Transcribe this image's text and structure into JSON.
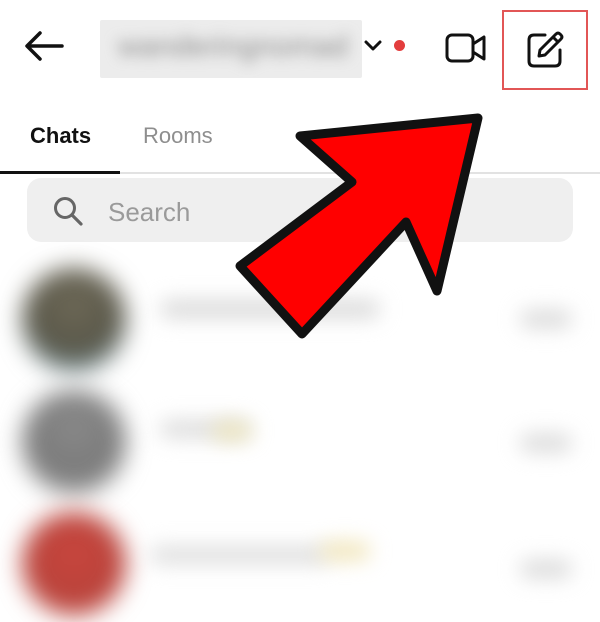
{
  "header": {
    "username": "wanderingnomad",
    "back_icon": "back-arrow-icon",
    "dropdown_icon": "chevron-down-icon",
    "video_icon": "video-camera-icon",
    "compose_icon": "edit-compose-icon"
  },
  "tabs": [
    {
      "label": "Chats",
      "active": true
    },
    {
      "label": "Rooms",
      "active": false
    }
  ],
  "search": {
    "placeholder": "Search",
    "value": "",
    "icon": "search-icon"
  },
  "annotation": {
    "type": "arrow",
    "color": "#ff0000",
    "points_to": "compose-button"
  },
  "colors": {
    "accent_red": "#e33d3d",
    "highlight_border": "#e25656",
    "inactive_text": "#8e8e8e"
  }
}
